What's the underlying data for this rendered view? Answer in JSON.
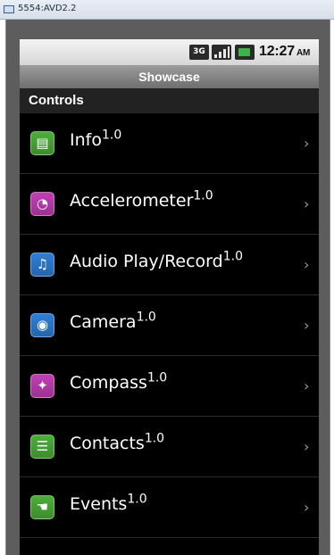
{
  "emulator": {
    "window_title": "5554:AVD2.2"
  },
  "status_bar": {
    "network": "3G",
    "time": "12:27",
    "ampm": "AM"
  },
  "app": {
    "title": "Showcase"
  },
  "section": {
    "header": "Controls"
  },
  "list": {
    "items": [
      {
        "label": "Info",
        "version": "1.0",
        "icon": "info-icon",
        "icon_color": "#4caf3a",
        "glyph": "▤"
      },
      {
        "label": "Accelerometer",
        "version": "1.0",
        "icon": "accelerometer-icon",
        "icon_color": "#c23fb5",
        "glyph": "◔"
      },
      {
        "label": "Audio Play/Record",
        "version": "1.0",
        "icon": "audio-icon",
        "icon_color": "#2f7fd6",
        "glyph": "♫"
      },
      {
        "label": "Camera",
        "version": "1.0",
        "icon": "camera-icon",
        "icon_color": "#2f7fd6",
        "glyph": "◉"
      },
      {
        "label": "Compass",
        "version": "1.0",
        "icon": "compass-icon",
        "icon_color": "#c23fb5",
        "glyph": "✦"
      },
      {
        "label": "Contacts",
        "version": "1.0",
        "icon": "contacts-icon",
        "icon_color": "#4caf3a",
        "glyph": "☰"
      },
      {
        "label": "Events",
        "version": "1.0",
        "icon": "events-icon",
        "icon_color": "#4caf3a",
        "glyph": "☚"
      }
    ],
    "chevron": "›"
  }
}
